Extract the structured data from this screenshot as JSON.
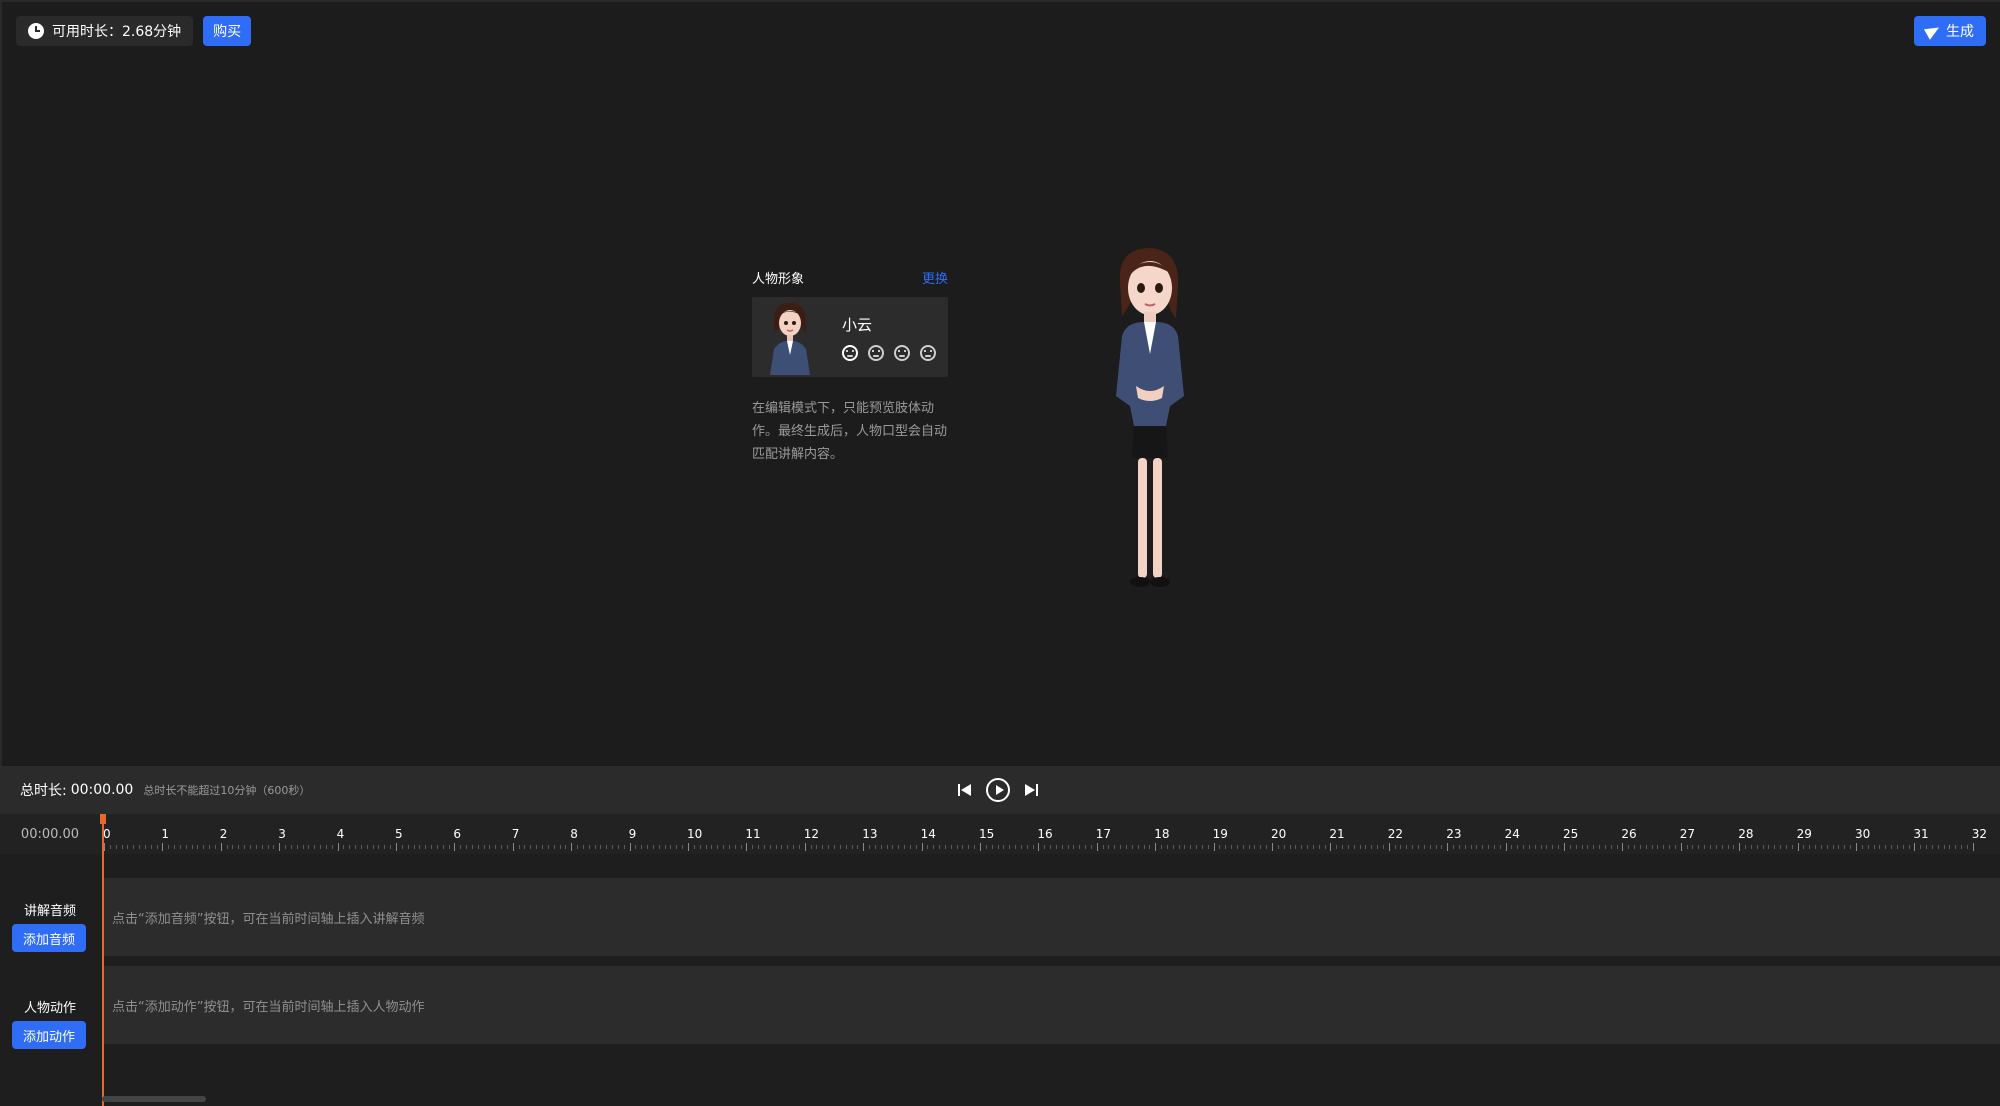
{
  "header": {
    "quota_label": "可用时长：2.68分钟",
    "buy_label": "购买",
    "generate_label": "生成"
  },
  "character_panel": {
    "title": "人物形象",
    "change_label": "更换",
    "character_name": "小云",
    "hint": "在编辑模式下，只能预览肢体动作。最终生成后，人物口型会自动匹配讲解内容。"
  },
  "controls": {
    "total_label": "总时长:",
    "total_value": "00:00.00",
    "limit_text": "总时长不能超过10分钟（600秒）"
  },
  "timeline": {
    "current_time": "00:00.00",
    "ticks": [
      "0",
      "1",
      "2",
      "3",
      "4",
      "5",
      "6",
      "7",
      "8",
      "9",
      "10",
      "11",
      "12",
      "13",
      "14",
      "15",
      "16",
      "17",
      "18",
      "19",
      "20",
      "21",
      "22",
      "23",
      "24",
      "25",
      "26",
      "27",
      "28",
      "29",
      "30",
      "31",
      "32"
    ],
    "tracks": [
      {
        "title": "讲解音频",
        "button": "添加音频",
        "placeholder": "点击“添加音频”按钮，可在当前时间轴上插入讲解音频"
      },
      {
        "title": "人物动作",
        "button": "添加动作",
        "placeholder": "点击“添加动作”按钮，可在当前时间轴上插入人物动作"
      }
    ]
  },
  "colors": {
    "accent": "#2f6df6",
    "playhead": "#e8682a"
  }
}
